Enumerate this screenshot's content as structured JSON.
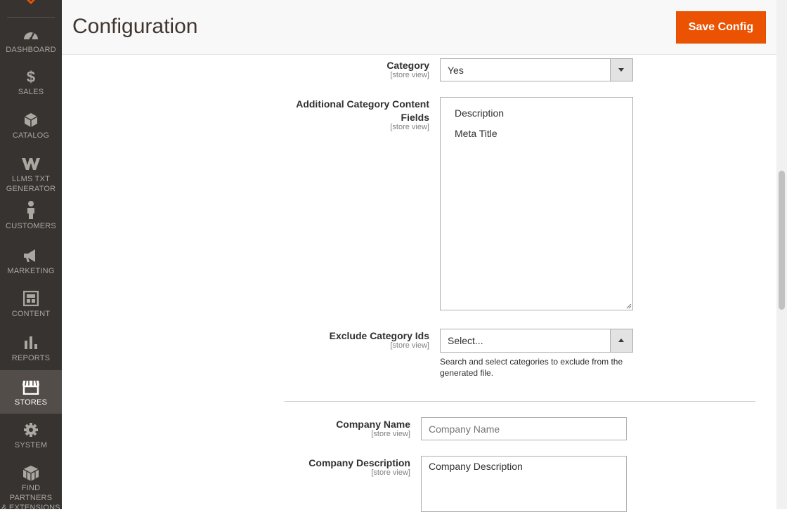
{
  "sidebar": {
    "logo_icon": "magento-logo-icon",
    "items": [
      {
        "label": "DASHBOARD",
        "icon": "dashboard-icon"
      },
      {
        "label": "SALES",
        "icon": "dollar-icon"
      },
      {
        "label": "CATALOG",
        "icon": "box-icon"
      },
      {
        "label": "LLMS TXT GENERATOR",
        "label_line1": "LLMS TXT",
        "label_line2": "GENERATOR",
        "icon": "w-logo-icon"
      },
      {
        "label": "CUSTOMERS",
        "icon": "person-icon"
      },
      {
        "label": "MARKETING",
        "icon": "megaphone-icon"
      },
      {
        "label": "CONTENT",
        "icon": "layout-icon"
      },
      {
        "label": "REPORTS",
        "icon": "bar-chart-icon"
      },
      {
        "label": "STORES",
        "icon": "store-icon",
        "active": true
      },
      {
        "label": "SYSTEM",
        "icon": "gear-icon"
      },
      {
        "label": "FIND PARTNERS & EXTENSIONS",
        "label_line1": "FIND PARTNERS",
        "label_line2": "& EXTENSIONS",
        "icon": "blocks-icon"
      }
    ]
  },
  "header": {
    "title": "Configuration",
    "save_label": "Save Config"
  },
  "form": {
    "category": {
      "label": "Category",
      "scope": "[store view]",
      "value": "Yes"
    },
    "additional_fields": {
      "label_line1": "Additional Category Content",
      "label_line2": "Fields",
      "scope": "[store view]",
      "options": [
        "Description",
        "Meta Title"
      ]
    },
    "exclude_ids": {
      "label": "Exclude Category Ids",
      "scope": "[store view]",
      "value": "Select...",
      "note_line1": "Search and select categories to exclude from the",
      "note_line2": "generated file."
    },
    "company_name": {
      "label": "Company Name",
      "scope": "[store view]",
      "placeholder": "Company Name"
    },
    "company_description": {
      "label": "Company Description",
      "scope": "[store view]",
      "placeholder": "Company Description"
    }
  },
  "colors": {
    "sidebar_bg": "#373330",
    "sidebar_active": "#524d49",
    "accent": "#eb5202"
  }
}
